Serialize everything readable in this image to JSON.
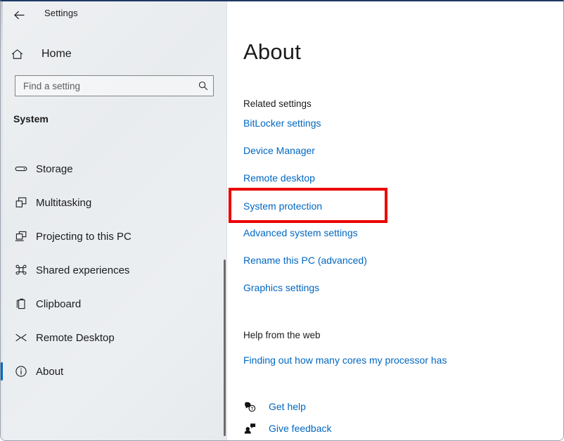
{
  "window": {
    "title": "Settings",
    "back_icon": "back-arrow-icon",
    "controls": {
      "minimize": "–",
      "maximize": "□",
      "close": "✕"
    }
  },
  "sidebar": {
    "home_label": "Home",
    "home_icon": "home-icon",
    "search": {
      "placeholder": "Find a setting",
      "value": "",
      "icon": "search-icon"
    },
    "section_title": "System",
    "items": [
      {
        "label": "Storage",
        "icon": "storage-drive-icon",
        "selected": false
      },
      {
        "label": "Multitasking",
        "icon": "multitasking-icon",
        "selected": false
      },
      {
        "label": "Projecting to this PC",
        "icon": "projecting-icon",
        "selected": false
      },
      {
        "label": "Shared experiences",
        "icon": "shared-experiences-icon",
        "selected": false
      },
      {
        "label": "Clipboard",
        "icon": "clipboard-icon",
        "selected": false
      },
      {
        "label": "Remote Desktop",
        "icon": "remote-desktop-icon",
        "selected": false
      },
      {
        "label": "About",
        "icon": "info-circle-icon",
        "selected": true
      }
    ]
  },
  "main": {
    "page_title": "About",
    "related_settings_heading": "Related settings",
    "related_links": [
      "BitLocker settings",
      "Device Manager",
      "Remote desktop",
      "System protection",
      "Advanced system settings",
      "Rename this PC (advanced)",
      "Graphics settings"
    ],
    "help_heading": "Help from the web",
    "help_link": "Finding out how many cores my processor has",
    "footer": [
      {
        "label": "Get help",
        "icon": "get-help-icon"
      },
      {
        "label": "Give feedback",
        "icon": "give-feedback-icon"
      }
    ]
  },
  "annotation": {
    "highlight_target": "System protection",
    "highlight_color": "#ec0000"
  },
  "colors": {
    "accent": "#0067c0",
    "link": "#0067c0",
    "text": "#1b1b1b",
    "sidebar_bg": "#eceff2",
    "highlight": "#ec0000"
  }
}
